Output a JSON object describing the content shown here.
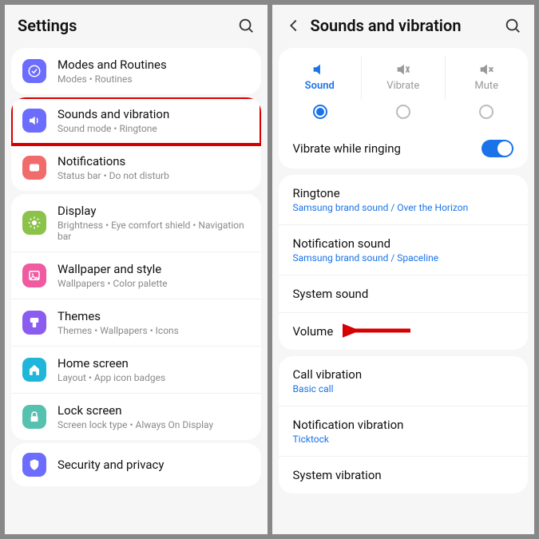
{
  "left": {
    "title": "Settings",
    "groups": [
      {
        "items": [
          {
            "key": "modes",
            "title": "Modes and Routines",
            "sub": "Modes  •  Routines",
            "color": "#6c6cff",
            "icon": "check-circle"
          }
        ]
      },
      {
        "items": [
          {
            "key": "sounds",
            "title": "Sounds and vibration",
            "sub": "Sound mode  •  Ringtone",
            "color": "#6c6cff",
            "icon": "speaker",
            "highlighted": true
          },
          {
            "key": "notifications",
            "title": "Notifications",
            "sub": "Status bar  •  Do not disturb",
            "color": "#f26b6b",
            "icon": "bell-card"
          }
        ]
      },
      {
        "items": [
          {
            "key": "display",
            "title": "Display",
            "sub": "Brightness  •  Eye comfort shield  •  Navigation bar",
            "color": "#8bc34a",
            "icon": "sun"
          },
          {
            "key": "wallpaper",
            "title": "Wallpaper and style",
            "sub": "Wallpapers  •  Color palette",
            "color": "#ef5aa0",
            "icon": "image"
          },
          {
            "key": "themes",
            "title": "Themes",
            "sub": "Themes  •  Wallpapers  •  Icons",
            "color": "#8a5cf0",
            "icon": "brush"
          },
          {
            "key": "home",
            "title": "Home screen",
            "sub": "Layout  •  App icon badges",
            "color": "#1fb6d9",
            "icon": "home"
          },
          {
            "key": "lock",
            "title": "Lock screen",
            "sub": "Screen lock type  •  Always On Display",
            "color": "#57c1b0",
            "icon": "lock"
          }
        ]
      },
      {
        "items": [
          {
            "key": "security",
            "title": "Security and privacy",
            "sub": "",
            "color": "#6c6cff",
            "icon": "shield"
          }
        ]
      }
    ]
  },
  "right": {
    "title": "Sounds and vibration",
    "modes": [
      {
        "key": "sound",
        "label": "Sound",
        "active": true,
        "icon": "speaker"
      },
      {
        "key": "vibrate",
        "label": "Vibrate",
        "active": false,
        "icon": "vibrate"
      },
      {
        "key": "mute",
        "label": "Mute",
        "active": false,
        "icon": "mute"
      }
    ],
    "vibrate_ringing": {
      "label": "Vibrate while ringing",
      "on": true
    },
    "items1": [
      {
        "title": "Ringtone",
        "sub": "Samsung brand sound / Over the Horizon"
      },
      {
        "title": "Notification sound",
        "sub": "Samsung brand sound / Spaceline"
      },
      {
        "title": "System sound",
        "sub": ""
      },
      {
        "title": "Volume",
        "sub": "",
        "arrow": true
      }
    ],
    "items2": [
      {
        "title": "Call vibration",
        "sub": "Basic call"
      },
      {
        "title": "Notification vibration",
        "sub": "Ticktock"
      },
      {
        "title": "System vibration",
        "sub": ""
      }
    ]
  }
}
